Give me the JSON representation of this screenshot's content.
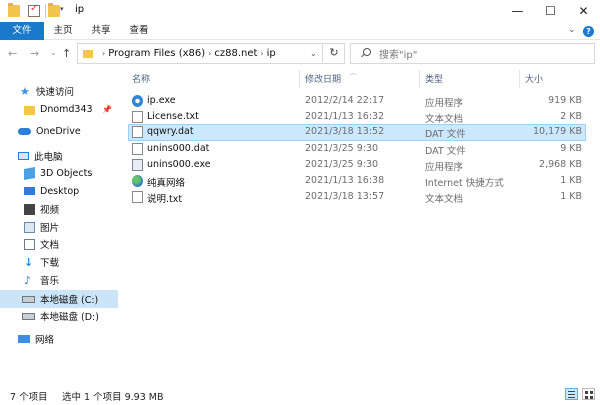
{
  "window": {
    "title": "ip",
    "minimize": "—",
    "maximize": "☐",
    "close": "✕"
  },
  "ribbon": {
    "tabs": [
      "文件",
      "主页",
      "共享",
      "查看"
    ],
    "expand": "⌄",
    "help": "?"
  },
  "address": {
    "back": "←",
    "forward": "→",
    "recent": "⌄",
    "up": "↑",
    "crumbs": [
      "Program Files (x86)",
      "cz88.net",
      "ip"
    ],
    "crumb_sep": "›",
    "dropdown": "⌄",
    "refresh": "↻",
    "search_placeholder": "搜索\"ip\""
  },
  "sidebar": {
    "items": [
      {
        "label": "快速访问",
        "icon": "star-icon"
      },
      {
        "label": "Dnomd343",
        "icon": "folder-icon",
        "pinned": true
      },
      {
        "label": "OneDrive",
        "icon": "cloud-icon"
      },
      {
        "label": "此电脑",
        "icon": "computer-icon"
      },
      {
        "label": "3D Objects",
        "icon": "cube-icon"
      },
      {
        "label": "Desktop",
        "icon": "desktop-icon"
      },
      {
        "label": "视频",
        "icon": "video-icon"
      },
      {
        "label": "图片",
        "icon": "picture-icon"
      },
      {
        "label": "文档",
        "icon": "document-icon"
      },
      {
        "label": "下载",
        "icon": "download-icon"
      },
      {
        "label": "音乐",
        "icon": "music-icon"
      },
      {
        "label": "本地磁盘 (C:)",
        "icon": "drive-icon",
        "selected": true
      },
      {
        "label": "本地磁盘 (D:)",
        "icon": "drive-icon"
      },
      {
        "label": "网络",
        "icon": "network-icon"
      }
    ]
  },
  "columns": [
    "名称",
    "修改日期",
    "类型",
    "大小"
  ],
  "files": [
    {
      "name": "ip.exe",
      "date": "2012/2/14 22:17",
      "type": "应用程序",
      "size": "919 KB",
      "icon": "exe-icon"
    },
    {
      "name": "License.txt",
      "date": "2021/1/13 16:32",
      "type": "文本文档",
      "size": "2 KB",
      "icon": "text-file-icon"
    },
    {
      "name": "qqwry.dat",
      "date": "2021/3/18 13:52",
      "type": "DAT 文件",
      "size": "10,179 KB",
      "icon": "dat-file-icon",
      "selected": true
    },
    {
      "name": "unins000.dat",
      "date": "2021/3/25 9:30",
      "type": "DAT 文件",
      "size": "9 KB",
      "icon": "dat-file-icon"
    },
    {
      "name": "unins000.exe",
      "date": "2021/3/25 9:30",
      "type": "应用程序",
      "size": "2,968 KB",
      "icon": "uninstall-icon"
    },
    {
      "name": "纯真网络",
      "date": "2021/1/13 16:38",
      "type": "Internet 快捷方式",
      "size": "1 KB",
      "icon": "web-shortcut-icon"
    },
    {
      "name": "说明.txt",
      "date": "2021/3/18 13:57",
      "type": "文本文档",
      "size": "1 KB",
      "icon": "text-file-icon"
    }
  ],
  "status": {
    "count": "7 个项目",
    "selection": "选中 1 个项目  9.93 MB"
  }
}
